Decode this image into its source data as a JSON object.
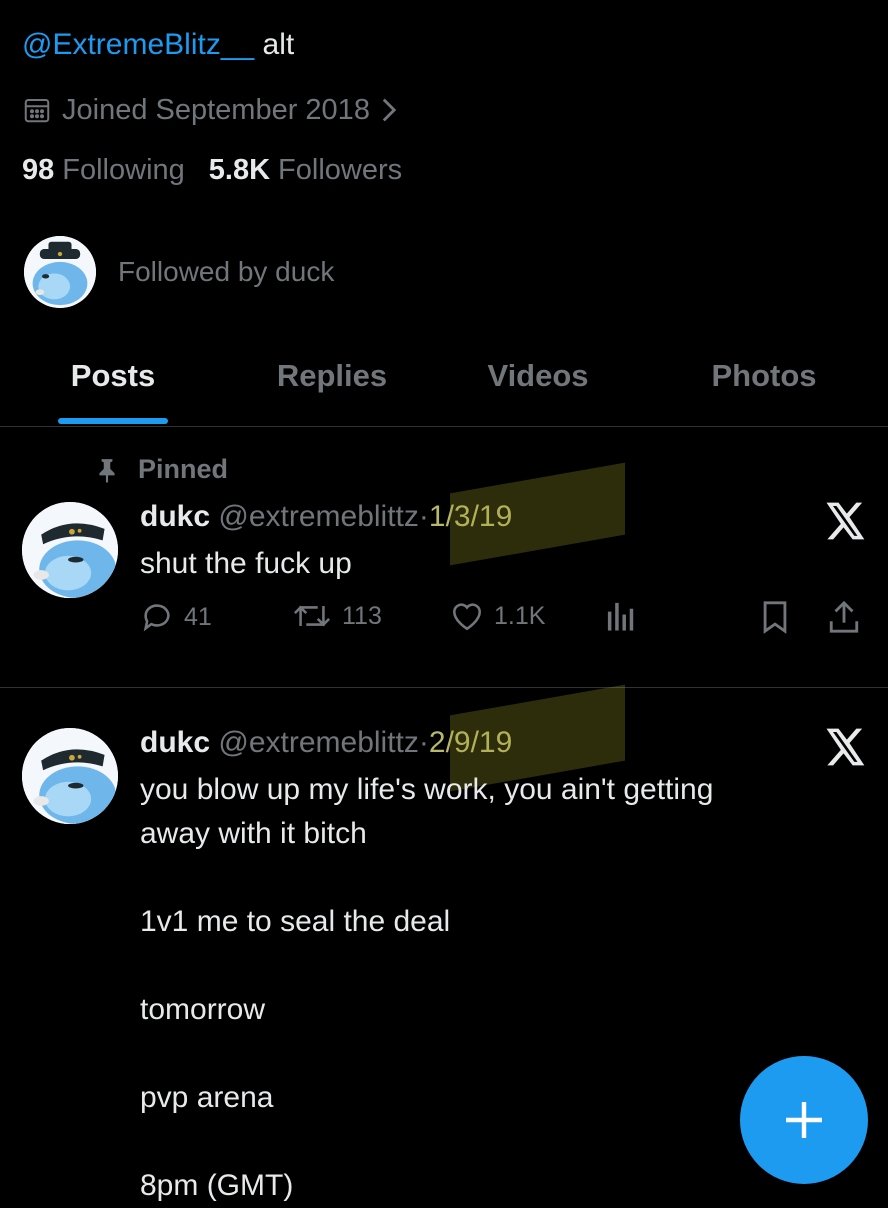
{
  "profile": {
    "bio_link": "@ExtremeBlitz__",
    "bio_rest": " alt",
    "joined": "Joined September 2018",
    "following_count": "98",
    "following_label": "Following",
    "followers_count": "5.8K",
    "followers_label": "Followers",
    "followed_by": "Followed by duck"
  },
  "tabs": [
    {
      "label": "Posts"
    },
    {
      "label": "Replies"
    },
    {
      "label": "Videos"
    },
    {
      "label": "Photos"
    }
  ],
  "pinned_label": "Pinned",
  "posts": [
    {
      "name": "dukc",
      "handle": "@extremeblittz",
      "sep": "·",
      "date": "1/3/19",
      "text": "shut the fuck up",
      "replies": "41",
      "reposts": "113",
      "likes": "1.1K"
    },
    {
      "name": "dukc",
      "handle": "@extremeblittz",
      "sep": "·",
      "date": "2/9/19",
      "text": "you blow up my life's work, you ain't getting\naway with it bitch\n\n1v1 me to seal the deal\n\ntomorrow\n\npvp arena\n\n8pm (GMT)"
    }
  ],
  "colors": {
    "accent": "#1d9bf0",
    "muted": "#71767b",
    "text": "#e7e9ea",
    "background": "#000000"
  }
}
